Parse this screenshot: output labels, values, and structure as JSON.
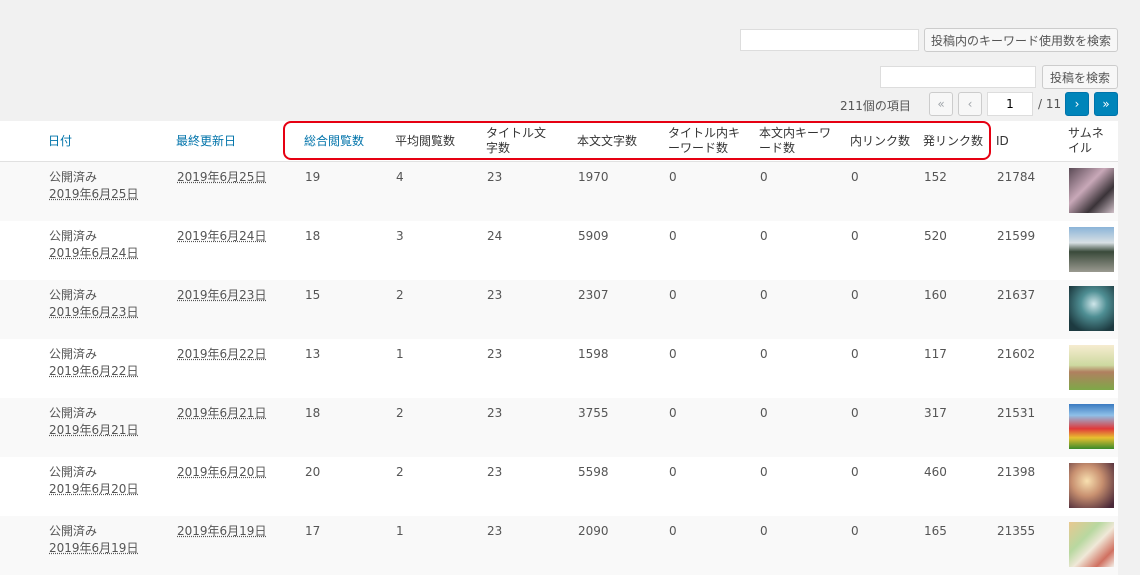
{
  "search": {
    "keyword_button": "投稿内のキーワード使用数を検索",
    "post_button": "投稿を検索"
  },
  "pagination": {
    "items": "211個の項目",
    "first": "«",
    "prev": "‹",
    "current": "1",
    "total": "/ 11",
    "next": "›",
    "last": "»"
  },
  "columns": {
    "date": "日付",
    "modified": "最終更新日",
    "total_views": "総合閲覧数",
    "avg_views": "平均閲覧数",
    "title_chars": "タイトル文字数",
    "body_chars": "本文文字数",
    "title_kw": "タイトル内キーワード数",
    "body_kw": "本文内キーワード数",
    "internal_links": "内リンク数",
    "outgoing_links": "発リンク数",
    "id": "ID",
    "thumbnail": "サムネイル"
  },
  "rows": [
    {
      "status": "公開済み",
      "date": "2019年6月25日",
      "modified": "2019年6月25日",
      "total": "19",
      "avg": "4",
      "title_chars": "23",
      "body_chars": "1970",
      "title_kw": "0",
      "body_kw": "0",
      "int_links": "0",
      "out_links": "152",
      "id": "21784",
      "thumb": "thumb-items"
    },
    {
      "status": "公開済み",
      "date": "2019年6月24日",
      "modified": "2019年6月24日",
      "total": "18",
      "avg": "3",
      "title_chars": "24",
      "body_chars": "5909",
      "title_kw": "0",
      "body_kw": "0",
      "int_links": "0",
      "out_links": "520",
      "id": "21599",
      "thumb": "thumb-road"
    },
    {
      "status": "公開済み",
      "date": "2019年6月23日",
      "modified": "2019年6月23日",
      "total": "15",
      "avg": "2",
      "title_chars": "23",
      "body_chars": "2307",
      "title_kw": "0",
      "body_kw": "0",
      "int_links": "0",
      "out_links": "160",
      "id": "21637",
      "thumb": "thumb-splash"
    },
    {
      "status": "公開済み",
      "date": "2019年6月22日",
      "modified": "2019年6月22日",
      "total": "13",
      "avg": "1",
      "title_chars": "23",
      "body_chars": "1598",
      "title_kw": "0",
      "body_kw": "0",
      "int_links": "0",
      "out_links": "117",
      "id": "21602",
      "thumb": "thumb-rabbit"
    },
    {
      "status": "公開済み",
      "date": "2019年6月21日",
      "modified": "2019年6月21日",
      "total": "18",
      "avg": "2",
      "title_chars": "23",
      "body_chars": "3755",
      "title_kw": "0",
      "body_kw": "0",
      "int_links": "0",
      "out_links": "317",
      "id": "21531",
      "thumb": "thumb-tulips"
    },
    {
      "status": "公開済み",
      "date": "2019年6月20日",
      "modified": "2019年6月20日",
      "total": "20",
      "avg": "2",
      "title_chars": "23",
      "body_chars": "5598",
      "title_kw": "0",
      "body_kw": "0",
      "int_links": "0",
      "out_links": "460",
      "id": "21398",
      "thumb": "thumb-sunset"
    },
    {
      "status": "公開済み",
      "date": "2019年6月19日",
      "modified": "2019年6月19日",
      "total": "17",
      "avg": "1",
      "title_chars": "23",
      "body_chars": "2090",
      "title_kw": "0",
      "body_kw": "0",
      "int_links": "0",
      "out_links": "165",
      "id": "21355",
      "thumb": "thumb-cards"
    }
  ],
  "colors": {
    "link": "#0073aa",
    "highlight": "#e60012",
    "active_page": "#0085ba"
  }
}
